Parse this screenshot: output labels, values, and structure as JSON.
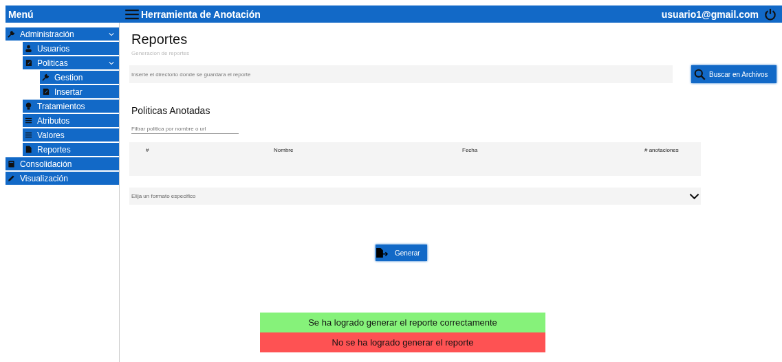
{
  "sidebar": {
    "title": "Menú",
    "items": [
      {
        "label": "Administración",
        "kind": "tool",
        "expanded": true,
        "children": [
          {
            "label": "Usuarios",
            "kind": "user"
          },
          {
            "label": "Politicas",
            "kind": "document",
            "expanded": true,
            "children": [
              {
                "label": "Gestion",
                "kind": "tool"
              },
              {
                "label": "Insertar",
                "kind": "document"
              }
            ]
          },
          {
            "label": "Tratamientos",
            "kind": "idea"
          },
          {
            "label": "Atributos",
            "kind": "list"
          },
          {
            "label": "Valores",
            "kind": "list"
          },
          {
            "label": "Reportes",
            "kind": "file"
          }
        ]
      },
      {
        "label": "Consolidación",
        "kind": "book"
      },
      {
        "label": "Visualización",
        "kind": "edit"
      }
    ]
  },
  "header": {
    "title": "Herramienta de Anotación",
    "user": "usuario1@gmail.com"
  },
  "page": {
    "title": "Reportes",
    "subtitle": "Generacion de reportes",
    "directory_placeholder": "Inserte el directorio donde se guardara el reporte",
    "browse_button": "Buscar en Archivos"
  },
  "policies": {
    "title": "Politicas Anotadas",
    "filter_placeholder": "Filtrar politica por nombre o url",
    "table": {
      "columns": [
        "#",
        "Nombre",
        "Fecha",
        "# anotaciones"
      ]
    }
  },
  "format_select": {
    "placeholder": "Elija un formato especifico"
  },
  "generate_button": "Generar",
  "alerts": [
    {
      "kind": "success",
      "text": "Se ha logrado generar el reporte correctamente"
    },
    {
      "kind": "error",
      "text": "No se ha logrado generar el reporte"
    }
  ]
}
